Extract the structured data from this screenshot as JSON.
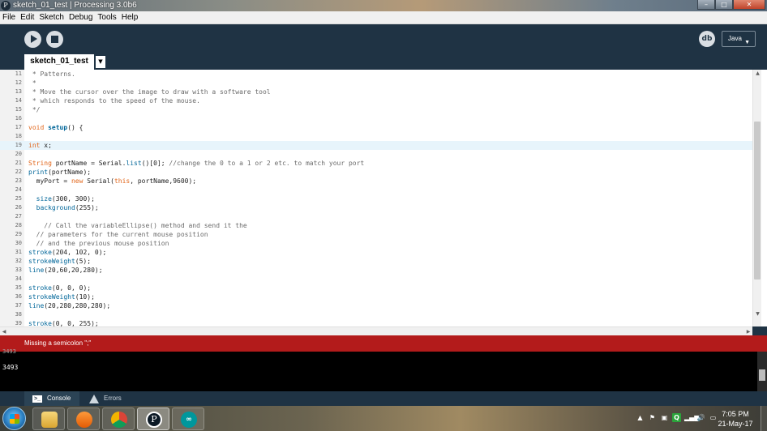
{
  "window": {
    "title": "sketch_01_test | Processing 3.0b6",
    "app_icon_letter": "P",
    "minimize_glyph": "–",
    "maximize_glyph": "□",
    "close_glyph": "✕"
  },
  "menu": [
    "File",
    "Edit",
    "Sketch",
    "Debug",
    "Tools",
    "Help"
  ],
  "toolbar": {
    "debug_glyph": "db",
    "mode": "Java",
    "mode_caret": "▼"
  },
  "tabs": {
    "active": "sketch_01_test",
    "menu_glyph": "▼"
  },
  "editor": {
    "current_line": 19,
    "lines": [
      {
        "n": "11",
        "text": " * Patterns."
      },
      {
        "n": "12",
        "text": " *"
      },
      {
        "n": "13",
        "text": " * Move the cursor over the image to draw with a software tool"
      },
      {
        "n": "14",
        "text": " * which responds to the speed of the mouse."
      },
      {
        "n": "15",
        "text": " */"
      },
      {
        "n": "16",
        "text": ""
      },
      {
        "n": "17",
        "text": "void setup() {"
      },
      {
        "n": "18",
        "text": ""
      },
      {
        "n": "19",
        "text": "int x;"
      },
      {
        "n": "20",
        "text": ""
      },
      {
        "n": "21",
        "text": "String portName = Serial.list()[0]; //change the 0 to a 1 or 2 etc. to match your port"
      },
      {
        "n": "22",
        "text": "print(portName);"
      },
      {
        "n": "23",
        "text": "  myPort = new Serial(this, portName,9600);"
      },
      {
        "n": "24",
        "text": ""
      },
      {
        "n": "25",
        "text": "  size(300, 300);"
      },
      {
        "n": "26",
        "text": "  background(255);"
      },
      {
        "n": "27",
        "text": ""
      },
      {
        "n": "28",
        "text": "    // Call the variableEllipse() method and send it the"
      },
      {
        "n": "29",
        "text": "  // parameters for the current mouse position"
      },
      {
        "n": "30",
        "text": "  // and the previous mouse position"
      },
      {
        "n": "31",
        "text": "stroke(204, 102, 0);"
      },
      {
        "n": "32",
        "text": "strokeWeight(5);"
      },
      {
        "n": "33",
        "text": "line(20,60,20,280);"
      },
      {
        "n": "34",
        "text": ""
      },
      {
        "n": "35",
        "text": "stroke(0, 0, 0);"
      },
      {
        "n": "36",
        "text": "strokeWeight(10);"
      },
      {
        "n": "37",
        "text": "line(20,280,280,280);"
      },
      {
        "n": "38",
        "text": ""
      },
      {
        "n": "39",
        "text": "stroke(0, 0, 255);"
      }
    ]
  },
  "error": {
    "message": "Missing a semicolon \";\""
  },
  "console": {
    "partial_line": "3493",
    "line": "3493"
  },
  "footer": {
    "console_label": "Console",
    "errors_label": "Errors",
    "console_icon": ">_"
  },
  "taskbar": {
    "tray": [
      "▲",
      "⚑",
      "▣",
      "Q",
      "▂▄▆",
      "🔊",
      "▭"
    ],
    "time": "7:05 PM",
    "date": "21-May-17",
    "processing_letter": "P",
    "arduino_glyph": "∞"
  },
  "colors": {
    "toolbar_bg": "#1f3344",
    "error_bg": "#b31b1b",
    "keyword": "#e2661a",
    "function": "#006699",
    "comment": "#6b6b6b",
    "current_line": "#e7f4fb"
  }
}
